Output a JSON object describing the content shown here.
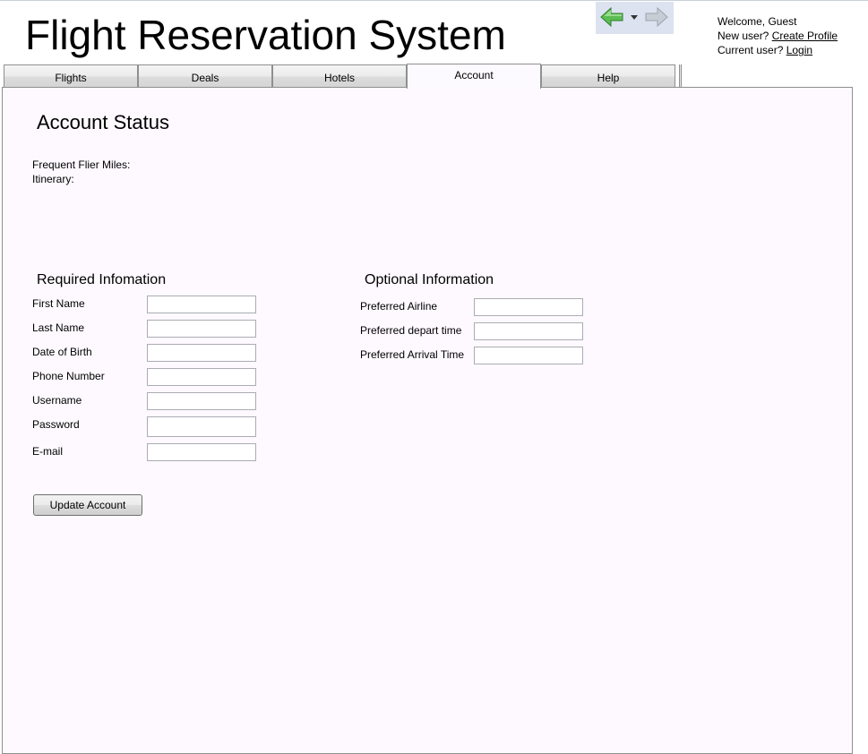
{
  "app": {
    "title": "Flight Reservation System"
  },
  "nav": {
    "back_icon": "back-arrow-icon",
    "dropdown_icon": "chevron-down-icon",
    "forward_icon": "forward-arrow-icon",
    "accent": "#4aa843"
  },
  "user_panel": {
    "welcome": "Welcome, Guest",
    "new_user_prefix": "New user? ",
    "create_profile_link": "Create Profile",
    "current_user_prefix": "Current user? ",
    "login_link": "Login"
  },
  "tabs": [
    {
      "label": "Flights"
    },
    {
      "label": "Deals"
    },
    {
      "label": "Hotels"
    },
    {
      "label": "Account",
      "active": true
    },
    {
      "label": "Help"
    }
  ],
  "account": {
    "heading": "Account Status",
    "frequent_flier_label": "Frequent Flier Miles:",
    "itinerary_label": "Itinerary:"
  },
  "required": {
    "heading": "Required Infomation",
    "fields": [
      {
        "label": "First Name",
        "value": ""
      },
      {
        "label": "Last Name",
        "value": ""
      },
      {
        "label": "Date of Birth",
        "value": ""
      },
      {
        "label": "Phone Number",
        "value": ""
      },
      {
        "label": "Username",
        "value": ""
      },
      {
        "label": "Password",
        "value": ""
      },
      {
        "label": "E-mail",
        "value": ""
      }
    ]
  },
  "optional": {
    "heading": "Optional Information",
    "fields": [
      {
        "label": "Preferred Airline",
        "value": ""
      },
      {
        "label": "Preferred depart time",
        "value": ""
      },
      {
        "label": "Preferred Arrival Time",
        "value": ""
      }
    ]
  },
  "actions": {
    "update_label": "Update Account"
  }
}
